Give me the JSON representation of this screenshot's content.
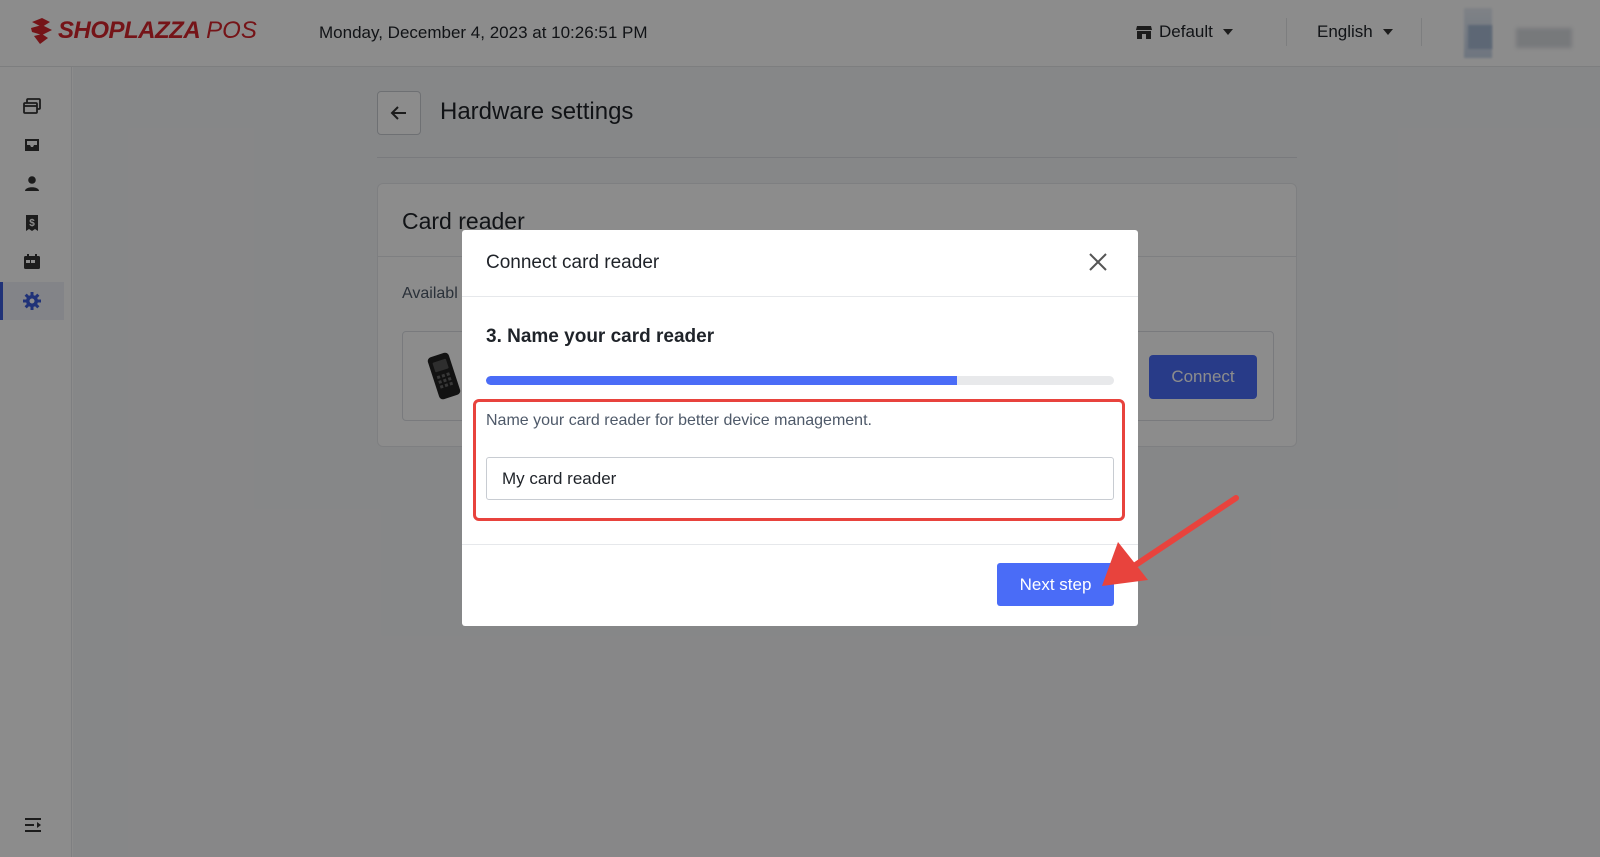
{
  "header": {
    "logo_text": "SHOPLAZZA",
    "logo_suffix": "POS",
    "datetime": "Monday, December 4, 2023 at 10:26:51 PM",
    "store_label": "Default",
    "language_label": "English"
  },
  "sidebar": {
    "items": [
      {
        "icon": "orders-icon"
      },
      {
        "icon": "inbox-icon"
      },
      {
        "icon": "customer-icon"
      },
      {
        "icon": "receipt-icon"
      },
      {
        "icon": "register-icon"
      },
      {
        "icon": "settings-icon",
        "active": true
      }
    ],
    "bottom_icon": "collapse-menu-icon"
  },
  "page": {
    "title": "Hardware settings",
    "card_title": "Card reader",
    "card_subtitle": "Availabl",
    "connect_label": "Connect"
  },
  "modal": {
    "title": "Connect card reader",
    "step_title": "3. Name your card reader",
    "progress": 0.75,
    "help_text": "Name your card reader for better device management.",
    "input_value": "My card reader",
    "next_label": "Next step"
  },
  "colors": {
    "brand_red": "#d6262c",
    "accent_blue": "#4a6cf7",
    "highlight_red": "#e8433d"
  }
}
